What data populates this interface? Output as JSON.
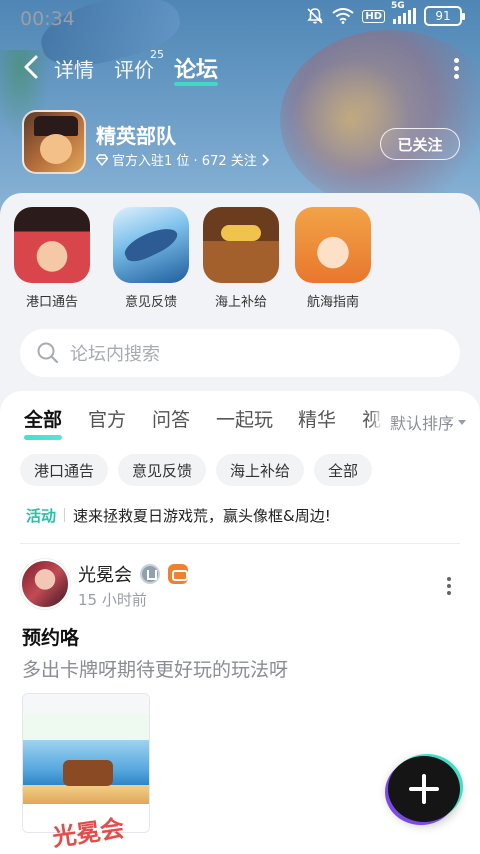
{
  "status_bar": {
    "time": "00:34",
    "network_label": "HD",
    "signal_label": "5G",
    "battery": "91"
  },
  "nav": {
    "tabs": [
      {
        "label": "详情"
      },
      {
        "label": "评价",
        "count": "25"
      },
      {
        "label": "论坛"
      }
    ]
  },
  "game": {
    "name": "精英部队",
    "subtitle": "官方入驻1 位 · 672 关注",
    "follow_label": "已关注"
  },
  "categories": [
    {
      "label": "港口通告"
    },
    {
      "label": "意见反馈"
    },
    {
      "label": "海上补给"
    },
    {
      "label": "航海指南"
    }
  ],
  "search": {
    "placeholder": "论坛内搜索"
  },
  "feed_tabs": [
    {
      "label": "全部"
    },
    {
      "label": "官方"
    },
    {
      "label": "问答"
    },
    {
      "label": "一起玩"
    },
    {
      "label": "精华"
    },
    {
      "label": "视"
    }
  ],
  "sort_label": "默认排序",
  "chips": [
    {
      "label": "港口通告"
    },
    {
      "label": "意见反馈"
    },
    {
      "label": "海上补给"
    },
    {
      "label": "全部"
    }
  ],
  "activity": {
    "tag": "活动",
    "text": "速来拯救夏日游戏荒，赢头像框&周边!"
  },
  "post": {
    "author": "光冕会",
    "time": "15 小时前",
    "title": "预约咯",
    "body": "多出卡牌呀期待更好玩的玩法呀",
    "watermark": "光冕会"
  },
  "colors": {
    "accent": "#3de0c5",
    "activity_tag": "#25c2a6",
    "watermark": "#e23a36"
  }
}
